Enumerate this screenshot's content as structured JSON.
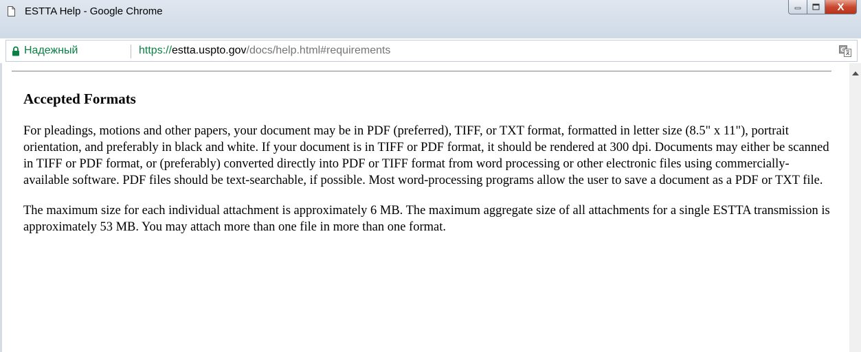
{
  "window": {
    "title": "ESTTA Help - Google Chrome",
    "close_glyph": "X"
  },
  "address_bar": {
    "security_label": "Надежный",
    "url_scheme": "https://",
    "url_host": "estta.uspto.gov",
    "url_path": "/docs/help.html#requirements"
  },
  "page": {
    "heading": "Accepted Formats",
    "paragraphs": [
      "For pleadings, motions and other papers, your document may be in PDF (preferred), TIFF, or TXT format, formatted in letter size (8.5\" x 11\"), portrait orientation, and preferably in black and white. If your document is in TIFF or PDF format, it should be rendered at 300 dpi. Documents may either be scanned in TIFF or PDF format, or (preferably) converted directly into PDF or TIFF format from word processing or other electronic files using commercially-available software. PDF files should be text-searchable, if possible. Most word-processing programs allow the user to save a document as a PDF or TXT file.",
      "The maximum size for each individual attachment is approximately 6 MB. The maximum aggregate size of all attachments for a single ESTTA transmission is approximately 53 MB. You may attach more than one file in more than one format."
    ]
  },
  "icons": {
    "page": "page-document-icon",
    "minimize": "minimize-icon",
    "maximize": "maximize-icon",
    "close": "close-icon",
    "secure": "lock-icon",
    "translate": "translate-icon",
    "scroll_up": "scroll-up-arrow-icon"
  },
  "colors": {
    "secure_green": "#0b8043",
    "url_path_gray": "#757575",
    "titlebar": "#d6e0eb",
    "close_red": "#c94a30"
  }
}
